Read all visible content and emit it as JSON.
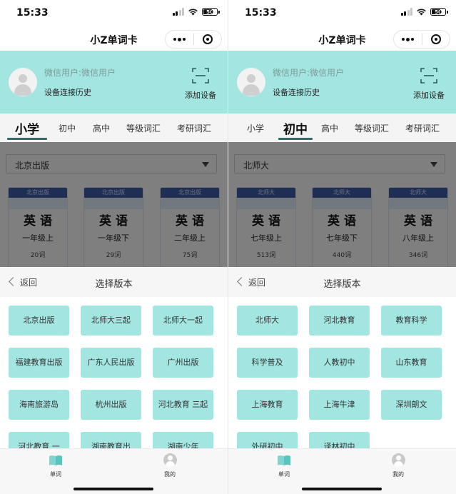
{
  "panels": [
    {
      "status": {
        "time": "15:33",
        "battery": "50"
      },
      "nav": {
        "title": "小Z单词卡"
      },
      "header": {
        "user_name": "微信用户:微信用户",
        "history": "设备连接历史",
        "add_device": "添加设备"
      },
      "tabs": [
        {
          "label": "小学",
          "active": true
        },
        {
          "label": "初中",
          "active": false
        },
        {
          "label": "高中",
          "active": false
        },
        {
          "label": "等级词汇",
          "active": false
        },
        {
          "label": "考研词汇",
          "active": false
        }
      ],
      "edition_select": {
        "value": "北京出版"
      },
      "books": [
        {
          "publisher": "北京出版",
          "subject": "英语",
          "grade": "一年级上",
          "words": "20词"
        },
        {
          "publisher": "北京出版",
          "subject": "英语",
          "grade": "一年级下",
          "words": "29词"
        },
        {
          "publisher": "北京出版",
          "subject": "英语",
          "grade": "二年级上",
          "words": "75词"
        }
      ],
      "sheet": {
        "back": "返回",
        "title": "选择版本",
        "options": [
          "北京出版",
          "北师大三起",
          "北师大一起",
          "福建教育出版",
          "广东人民出版",
          "广州出版",
          "海南旅游岛",
          "杭州出版",
          "河北教育 三起",
          "河北教育 一",
          "湖南教育出",
          "湖南少年"
        ]
      },
      "tabbar": {
        "words": "单词",
        "me": "我的"
      }
    },
    {
      "status": {
        "time": "15:33",
        "battery": "50"
      },
      "nav": {
        "title": "小Z单词卡"
      },
      "header": {
        "user_name": "微信用户:微信用户",
        "history": "设备连接历史",
        "add_device": "添加设备"
      },
      "tabs": [
        {
          "label": "小学",
          "active": false
        },
        {
          "label": "初中",
          "active": true
        },
        {
          "label": "高中",
          "active": false
        },
        {
          "label": "等级词汇",
          "active": false
        },
        {
          "label": "考研词汇",
          "active": false
        }
      ],
      "edition_select": {
        "value": "北师大"
      },
      "books": [
        {
          "publisher": "北师大",
          "subject": "英语",
          "grade": "七年级上",
          "words": "513词"
        },
        {
          "publisher": "北师大",
          "subject": "英语",
          "grade": "七年级下",
          "words": "440词"
        },
        {
          "publisher": "北师大",
          "subject": "英语",
          "grade": "八年级上",
          "words": "346词"
        }
      ],
      "sheet": {
        "back": "返回",
        "title": "选择版本",
        "options": [
          "北师大",
          "河北教育",
          "教育科学",
          "科学普及",
          "人教初中",
          "山东教育",
          "上海教育",
          "上海牛津",
          "深圳朗文",
          "外研初中",
          "译林初中"
        ]
      },
      "tabbar": {
        "words": "单词",
        "me": "我的"
      }
    }
  ],
  "colors": {
    "accent": "#a3e5e1",
    "tab_underline": "#2f6f69",
    "book_band": "#3f5fa8"
  }
}
